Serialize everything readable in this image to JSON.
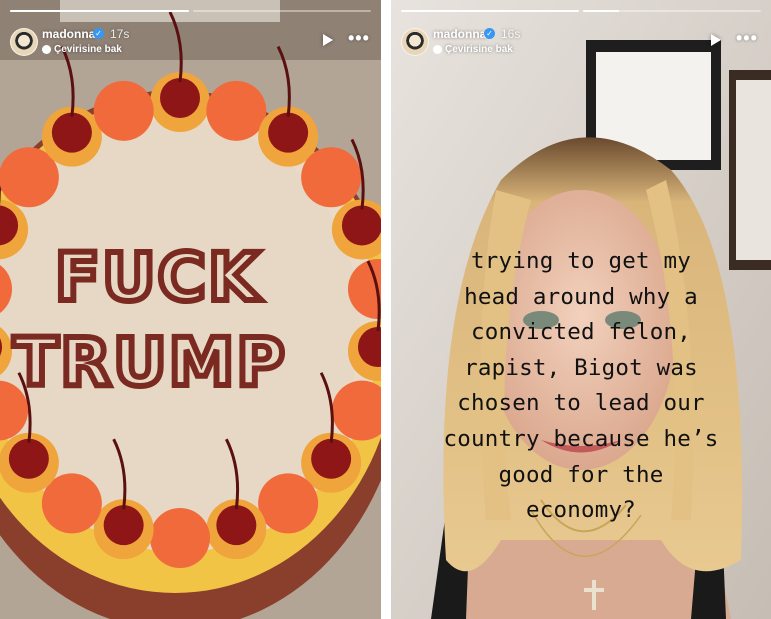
{
  "stories": [
    {
      "username": "madonna",
      "time": "17s",
      "translate_label": "Çevirisine bak",
      "progress": [
        1.0,
        0.0
      ],
      "cake_text": [
        "FUCK",
        "TRUMP"
      ],
      "icons": [
        "verified-badge-icon",
        "translate-icon",
        "play-icon",
        "more-options-icon"
      ]
    },
    {
      "username": "madonna",
      "time": "16s",
      "translate_label": "Çevirisine bak",
      "progress": [
        1.0,
        0.2
      ],
      "caption_lines": [
        "trying to get my",
        "head around why a",
        "convicted felon,",
        "rapist, Bigot was",
        "chosen to lead our",
        "country because he’s",
        "good for the",
        "economy?"
      ],
      "icons": [
        "verified-badge-icon",
        "translate-icon",
        "play-icon",
        "more-options-icon"
      ]
    }
  ],
  "colors": {
    "frosting": "#e7d8c5",
    "rosette_orange": "#f06a3c",
    "piping_yellow": "#f2c446",
    "cherry": "#8e1616",
    "lettering": "#7a2a20",
    "progress_active": "#ffffff"
  }
}
